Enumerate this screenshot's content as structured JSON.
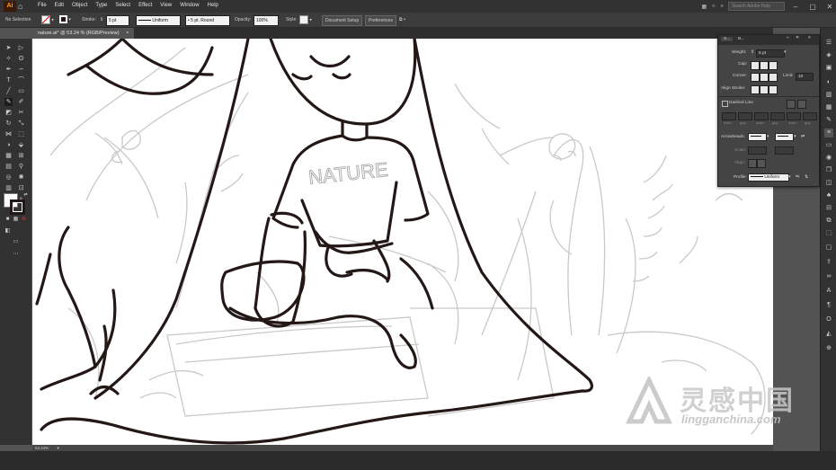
{
  "app": {
    "logo": "Ai",
    "home_icon": "home-icon"
  },
  "menu": [
    "File",
    "Edit",
    "Object",
    "Type",
    "Select",
    "Effect",
    "View",
    "Window",
    "Help"
  ],
  "menubar_right": {
    "search_placeholder": "Search Adobe Help"
  },
  "controlbar": {
    "selection_label": "No Selection",
    "stroke_label": "Stroke:",
    "stroke_value": "5 pt",
    "uniform_label": "Uniform",
    "brush_label": "5 pt. Round",
    "opacity_label": "Opacity:",
    "opacity_value": "100%",
    "style_label": "Style:",
    "document_setup": "Document Setup",
    "preferences": "Preferences"
  },
  "document_tab": {
    "title": "nature.ai* @ 53.24 % (RGB/Preview)",
    "close": "×"
  },
  "stroke_panel": {
    "tab1": "S...",
    "tab2": "B...",
    "weight_label": "Weight:",
    "weight_value": "5 pt",
    "cap_label": "Cap:",
    "corner_label": "Corner:",
    "limit_label": "Limit:",
    "limit_value": "10",
    "align_label": "Align Stroke:",
    "dashed_label": "Dashed Line",
    "dash_labels": [
      "dash",
      "gap",
      "dash",
      "gap",
      "dash",
      "gap"
    ],
    "arrowheads_label": "Arrowheads:",
    "scale_label": "Scale:",
    "align_arrow_label": "Align:",
    "profile_label": "Profile:",
    "profile_value": "Uniform"
  },
  "statusbar": {
    "zoom": "53.24%"
  },
  "watermark": {
    "brand_cn": "灵感中国",
    "brand_url": "lingganchina.com"
  },
  "colors": {
    "fill": "#ffffff",
    "stroke": "#231815",
    "accent": "#ff9a00"
  }
}
